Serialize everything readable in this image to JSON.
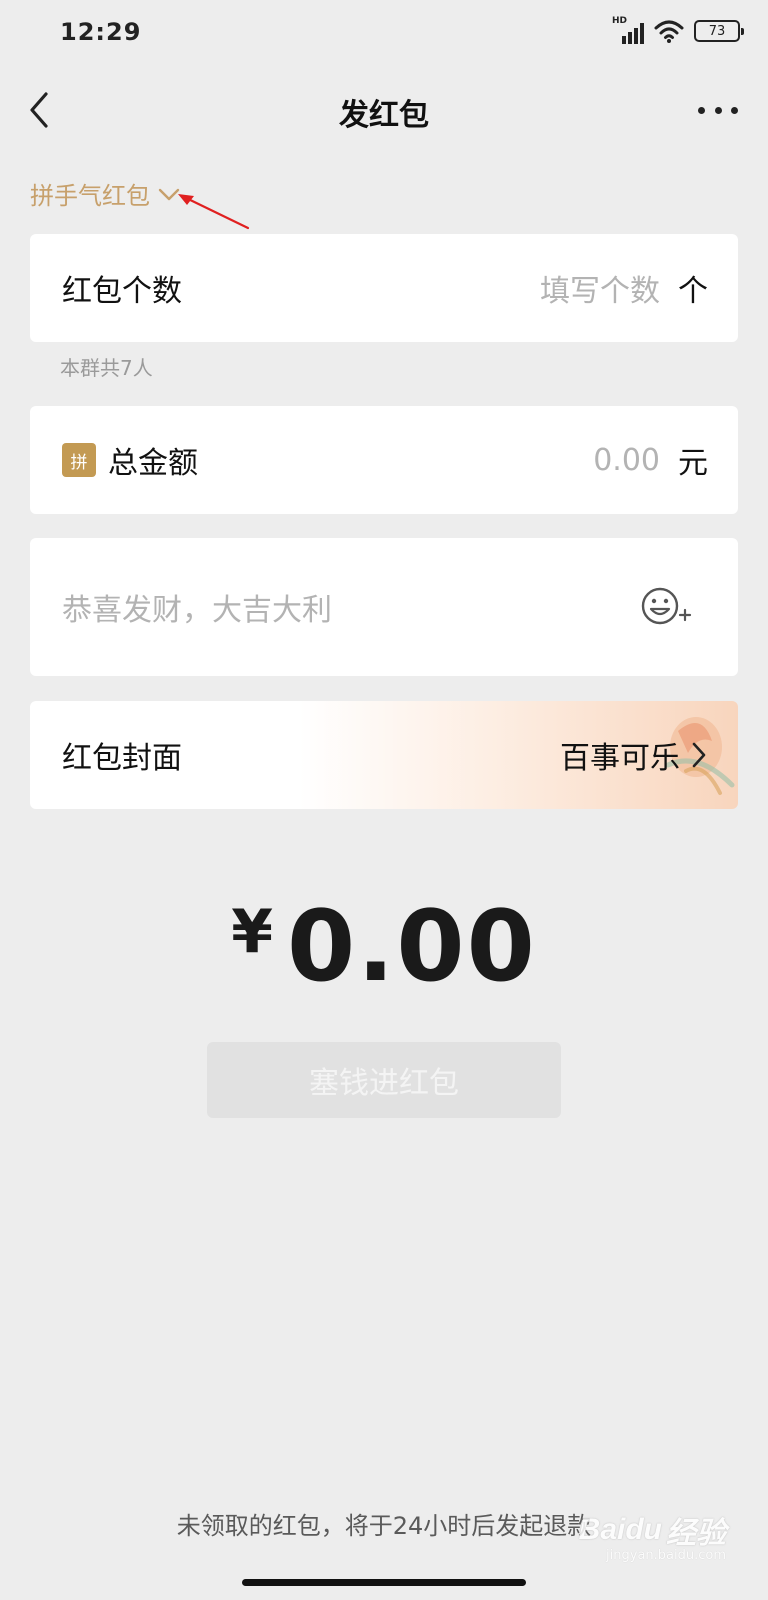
{
  "status_bar": {
    "time": "12:29",
    "network_label": "HD",
    "battery_level": "73",
    "icons": [
      "signal-icon",
      "wifi-icon",
      "battery-icon"
    ]
  },
  "header": {
    "title": "发红包",
    "back_icon": "chevron-left-icon",
    "more_icon": "more-horizontal-icon"
  },
  "packet_type": {
    "label": "拼手气红包",
    "icon": "chevron-down-icon"
  },
  "count_field": {
    "label": "红包个数",
    "placeholder": "填写个数",
    "unit": "个",
    "hint": "本群共7人"
  },
  "amount_field": {
    "badge": "拼",
    "label": "总金额",
    "placeholder": "0.00",
    "unit": "元"
  },
  "greeting_field": {
    "placeholder": "恭喜发财，大吉大利",
    "icon": "emoji-add-icon"
  },
  "cover_field": {
    "label": "红包封面",
    "value": "百事可乐",
    "icon": "chevron-right-icon"
  },
  "amount_display": {
    "currency": "¥",
    "value": "0.00"
  },
  "submit_button": {
    "label": "塞钱进红包",
    "enabled": false
  },
  "footer": {
    "notice": "未领取的红包，将于24小时后发起退款"
  },
  "watermark": {
    "brand": "Baidu",
    "brand_cn": "经验",
    "url": "jingyan.baidu.com"
  },
  "colors": {
    "background": "#ededed",
    "accent_gold": "#c7a06b",
    "badge_gold": "#c39a53",
    "placeholder": "#b3b3b3",
    "button_disabled": "#e1e1e1"
  }
}
